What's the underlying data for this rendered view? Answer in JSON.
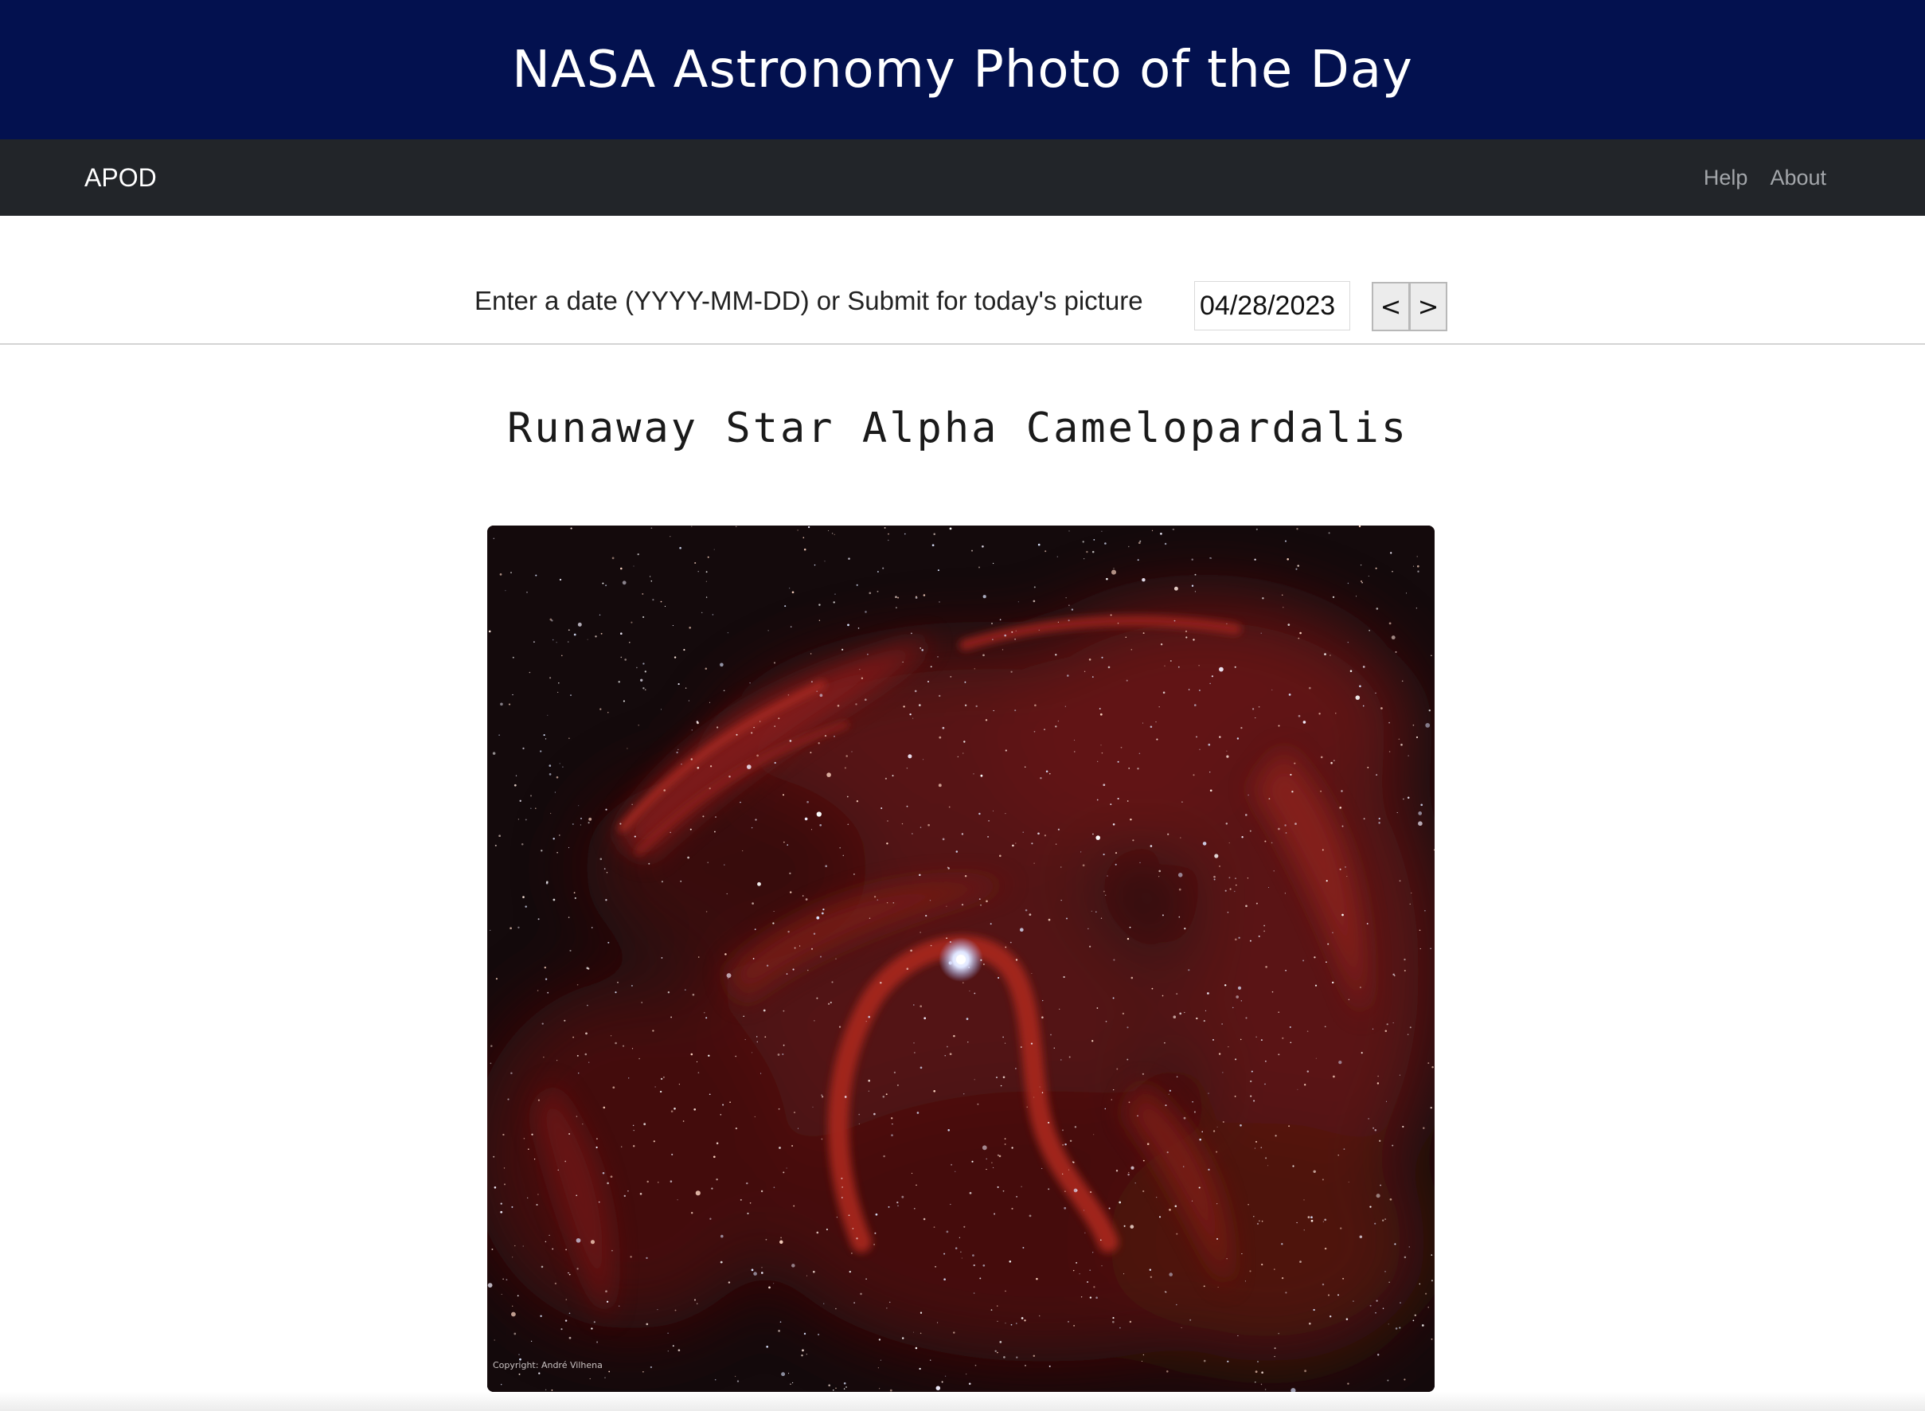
{
  "banner": {
    "title": "NASA Astronomy Photo of the Day"
  },
  "navbar": {
    "brand": "APOD",
    "links": [
      {
        "label": "Help"
      },
      {
        "label": "About"
      }
    ]
  },
  "date_picker": {
    "label": "Enter a date (YYYY-MM-DD) or Submit for today's picture",
    "value": "04/28/2023",
    "prev_label": "<",
    "next_label": ">"
  },
  "photo": {
    "title": "Runaway Star Alpha Camelopardalis",
    "credit": "Copyright: André Vilhena"
  },
  "colors": {
    "banner_bg": "#03114f",
    "navbar_bg": "#222529",
    "nebula_red": "#8e1c1a"
  }
}
